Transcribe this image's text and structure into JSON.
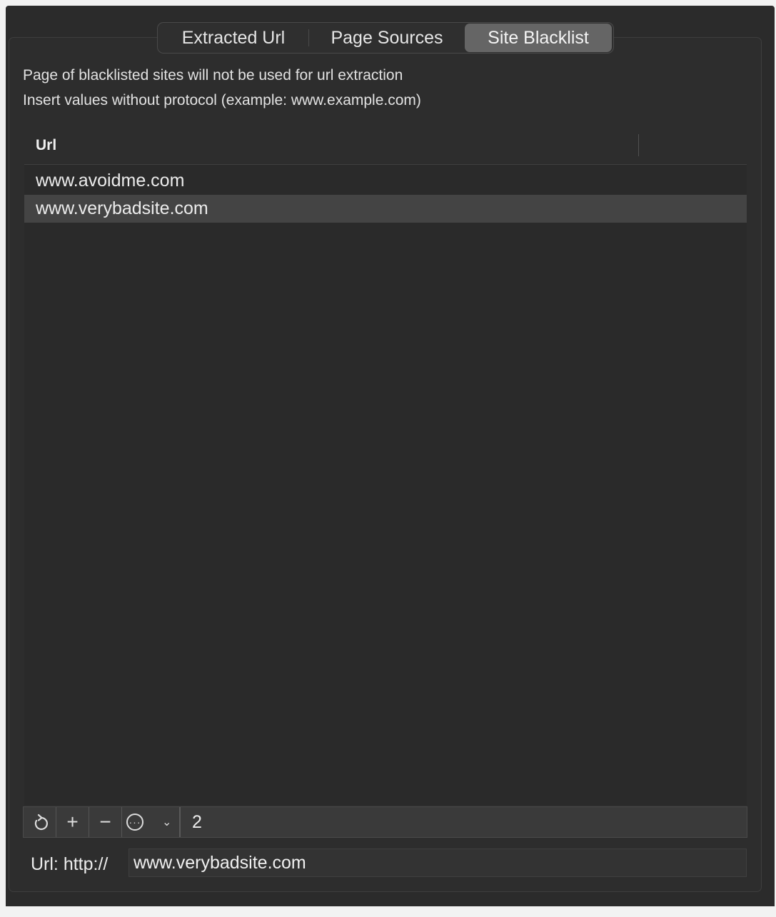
{
  "tabs": [
    {
      "label": "Extracted Url"
    },
    {
      "label": "Page Sources"
    },
    {
      "label": "Site Blacklist",
      "selected": true
    }
  ],
  "info": {
    "line1": "Page of blacklisted sites will not be used for url extraction",
    "line2": "Insert values without protocol (example: www.example.com)"
  },
  "table": {
    "column_header": "Url",
    "rows": [
      {
        "url": "www.avoidme.com"
      },
      {
        "url": "www.verybadsite.com",
        "selected": true
      }
    ]
  },
  "toolbar": {
    "refresh_icon": "refresh-icon",
    "add_symbol": "+",
    "remove_symbol": "−",
    "more_icon": "ellipsis-circle-icon",
    "chevron_icon": "chevron-down-icon",
    "count": "2"
  },
  "url_field": {
    "label": "Url: http://",
    "value": "www.verybadsite.com"
  },
  "colors": {
    "background": "#2b2b2b",
    "selected_tab": "#656565",
    "selected_row": "#444444"
  }
}
